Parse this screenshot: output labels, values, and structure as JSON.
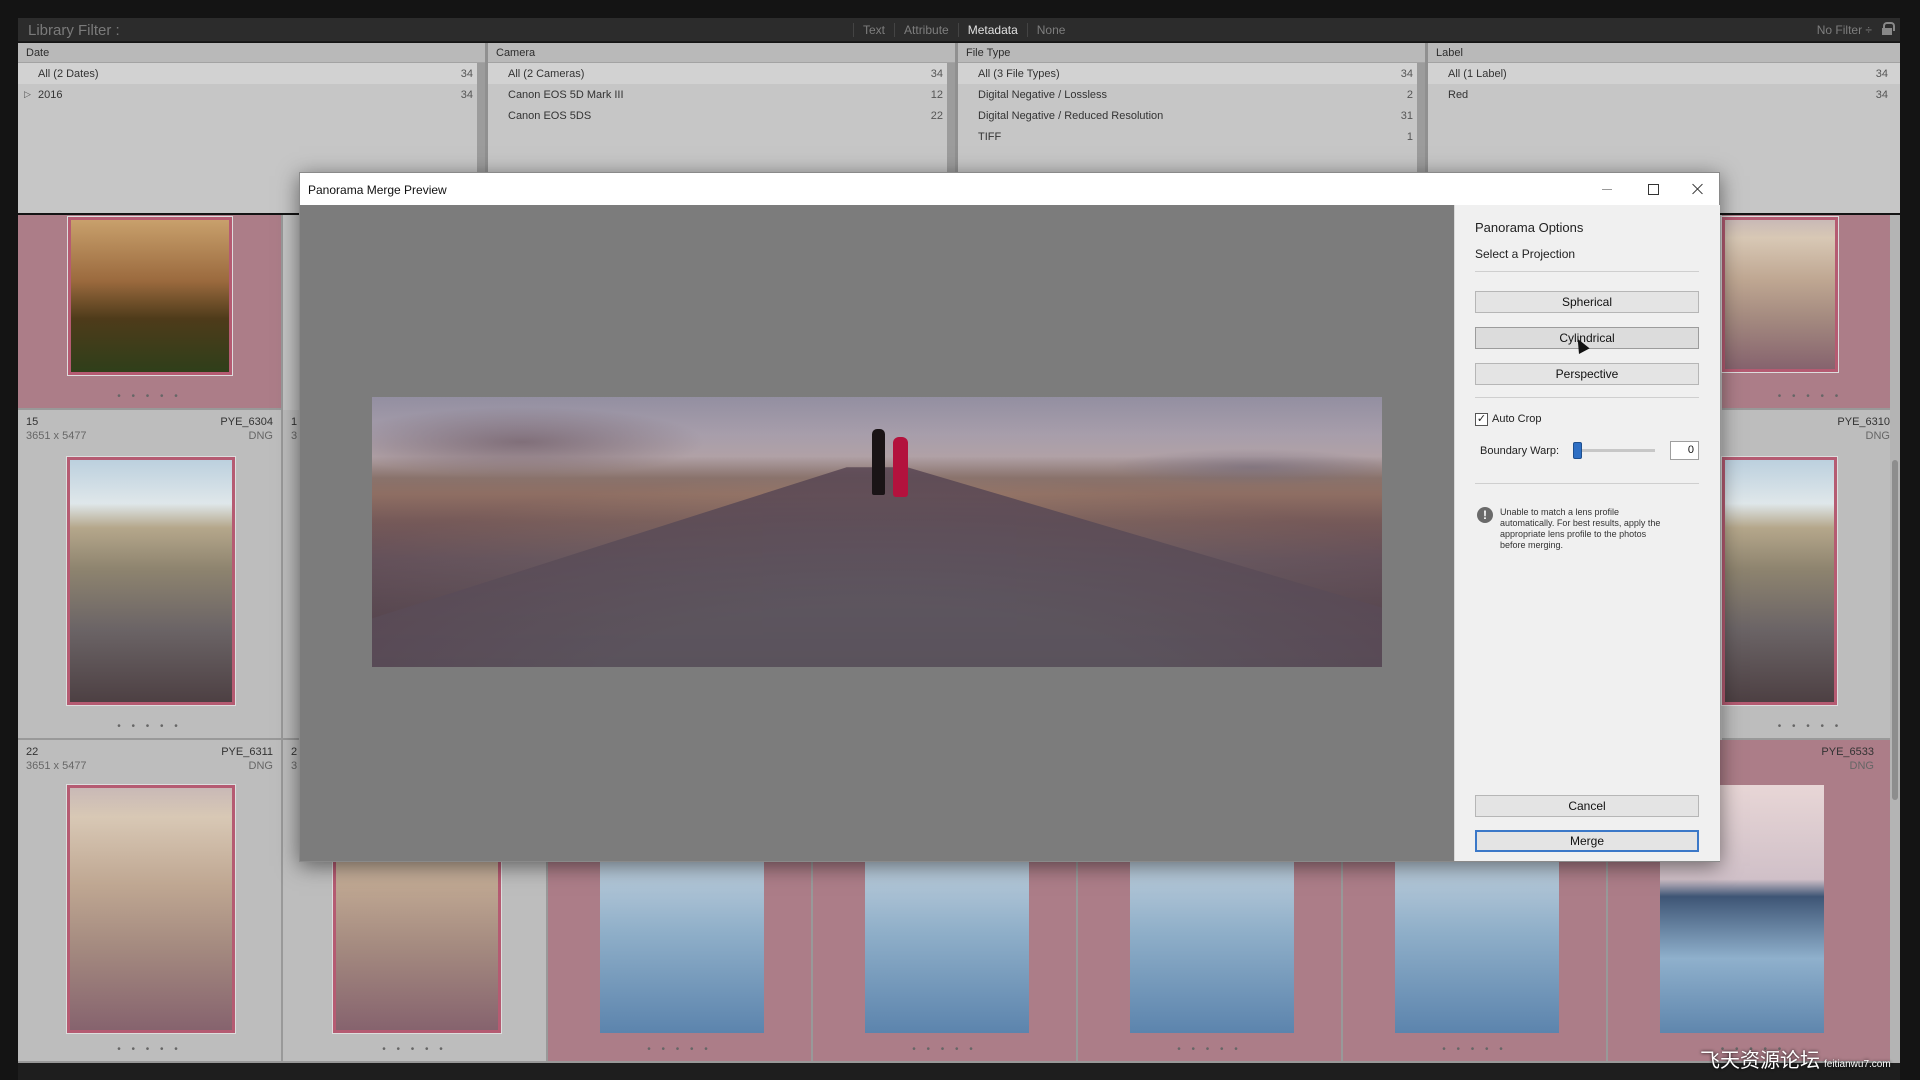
{
  "library_filter": {
    "title": "Library Filter :",
    "modes": [
      "Text",
      "Attribute",
      "Metadata",
      "None"
    ],
    "active_mode": "Metadata",
    "preset": "No Filter ÷"
  },
  "metadata_columns": [
    {
      "header": "Date",
      "rows": [
        {
          "label": "All (2 Dates)",
          "count": "34",
          "selected": true
        },
        {
          "label": "2016",
          "count": "34",
          "expander": "▷"
        }
      ]
    },
    {
      "header": "Camera",
      "rows": [
        {
          "label": "All (2 Cameras)",
          "count": "34",
          "selected": true
        },
        {
          "label": "Canon EOS 5D Mark III",
          "count": "12"
        },
        {
          "label": "Canon EOS 5DS",
          "count": "22"
        }
      ]
    },
    {
      "header": "File Type",
      "rows": [
        {
          "label": "All (3 File Types)",
          "count": "34",
          "selected": true
        },
        {
          "label": "Digital Negative / Lossless",
          "count": "2"
        },
        {
          "label": "Digital Negative / Reduced Resolution",
          "count": "31"
        },
        {
          "label": "TIFF",
          "count": "1"
        }
      ]
    },
    {
      "header": "Label",
      "rows": [
        {
          "label": "All (1 Label)",
          "count": "34",
          "selected": true
        },
        {
          "label": "Red",
          "count": "34"
        }
      ]
    }
  ],
  "grid": {
    "cell_15": {
      "index": "15",
      "dims": "3651 x 5477",
      "name": "PYE_6304",
      "type": "DNG"
    },
    "cell_22": {
      "index": "22",
      "dims": "3651 x 5477",
      "name": "PYE_6311",
      "type": "DNG"
    },
    "cell_right_mid": {
      "name": "PYE_6310",
      "type": "DNG"
    },
    "cell_right_bottom": {
      "name": "PYE_6533",
      "type": "DNG"
    },
    "cell_partial_index_mid": "1",
    "cell_partial_dims_mid": "3",
    "cell_partial_index_bottom": "2",
    "cell_partial_dims_bottom": "3",
    "dots": "• • • • •"
  },
  "dialog": {
    "title": "Panorama Merge Preview",
    "options_title": "Panorama Options",
    "projection_label": "Select a Projection",
    "projections": [
      "Spherical",
      "Cylindrical",
      "Perspective"
    ],
    "auto_crop_label": "Auto Crop",
    "auto_crop_checked": true,
    "auto_crop_mark": "✓",
    "boundary_warp_label": "Boundary Warp:",
    "boundary_warp_value": "0",
    "boundary_warp_fraction": 0,
    "warning_icon": "!",
    "warning_text": "Unable to match a lens profile automatically. For best results, apply the appropriate lens profile to the photos before merging.",
    "cancel_label": "Cancel",
    "merge_label": "Merge"
  },
  "watermark": {
    "text": "飞天资源论坛",
    "sub": "feitianwu7.com"
  },
  "colors": {
    "label_red": "#b55b72",
    "accent_blue": "#3b78c8",
    "pink_cell": "#ac7d88"
  },
  "icons": [
    "lock-icon",
    "minimize-icon",
    "maximize-icon",
    "close-icon",
    "warning-icon",
    "cursor-icon"
  ]
}
